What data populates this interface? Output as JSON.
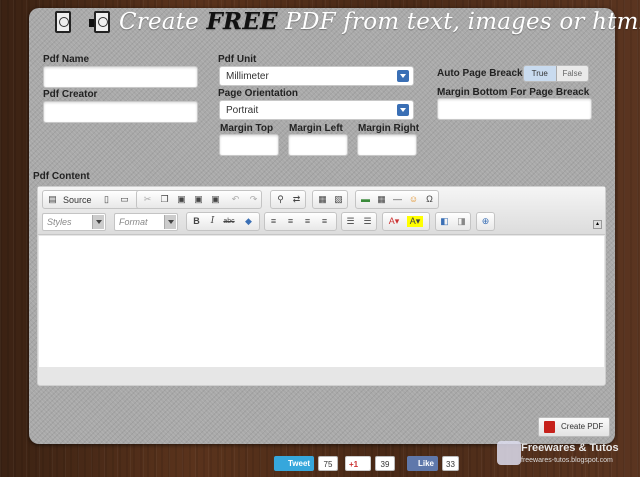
{
  "header": {
    "title_prefix": "Create ",
    "title_emph": "FREE",
    "title_suffix": " PDF from text, images or html"
  },
  "form": {
    "pdf_name_label": "Pdf Name",
    "pdf_name_value": "",
    "pdf_creator_label": "Pdf Creator",
    "pdf_creator_value": "",
    "pdf_unit_label": "Pdf Unit",
    "pdf_unit_value": "Millimeter",
    "page_orientation_label": "Page Orientation",
    "page_orientation_value": "Portrait",
    "margin_top_label": "Margin Top",
    "margin_left_label": "Margin Left",
    "margin_right_label": "Margin Right",
    "auto_page_break_label": "Auto Page Breack",
    "toggle_true": "True",
    "toggle_false": "False",
    "margin_bottom_label": "Margin Bottom For Page Breack",
    "pdf_content_label": "Pdf Content"
  },
  "editor": {
    "source_label": "Source",
    "styles_placeholder": "Styles",
    "format_placeholder": "Format",
    "bold": "B",
    "italic": "I",
    "strike": "abc",
    "omega": "Ω",
    "collapse": "▴"
  },
  "actions": {
    "create_pdf": "Create PDF"
  },
  "social": {
    "tweet": "Tweet",
    "tweet_count": "75",
    "gplus": "+1",
    "gplus_count": "39",
    "like": "Like",
    "like_count": "33"
  },
  "watermark": {
    "title": "Freewares & Tutos",
    "url": "freewares-tutos.blogspot.com"
  },
  "colors": {
    "panel": "#a9a9a9",
    "accent_blue": "#3a6fb5",
    "twitter": "#36a7dc",
    "facebook": "#5f78ab",
    "pdf_red": "#c6211b"
  }
}
